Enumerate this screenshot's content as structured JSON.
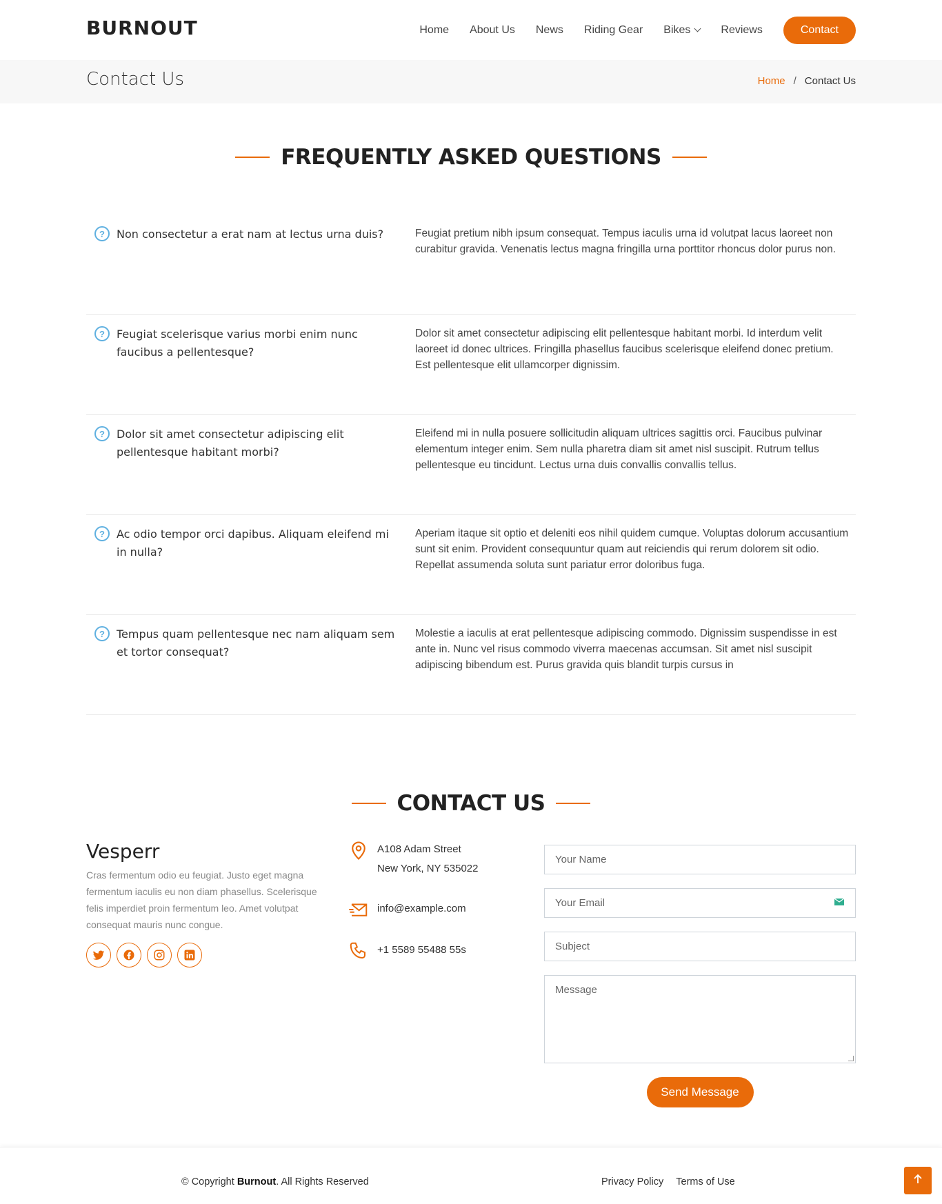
{
  "header": {
    "logo": "BURNOUT",
    "nav": [
      {
        "label": "Home"
      },
      {
        "label": "About Us"
      },
      {
        "label": "News"
      },
      {
        "label": "Riding Gear"
      },
      {
        "label": "Bikes"
      },
      {
        "label": "Reviews"
      }
    ],
    "contact_label": "Contact"
  },
  "breadcrumbs": {
    "title": "Contact Us",
    "home": "Home",
    "separator": "/",
    "current": "Contact Us"
  },
  "faq": {
    "title": "FREQUENTLY ASKED QUESTIONS",
    "items": [
      {
        "q": "Non consectetur a erat nam at lectus urna duis?",
        "a": "Feugiat pretium nibh ipsum consequat. Tempus iaculis urna id volutpat lacus laoreet non curabitur gravida. Venenatis lectus magna fringilla urna porttitor rhoncus dolor purus non."
      },
      {
        "q": "Feugiat scelerisque varius morbi enim nunc faucibus a pellentesque?",
        "a": "Dolor sit amet consectetur adipiscing elit pellentesque habitant morbi. Id interdum velit laoreet id donec ultrices. Fringilla phasellus faucibus scelerisque eleifend donec pretium. Est pellentesque elit ullamcorper dignissim."
      },
      {
        "q": "Dolor sit amet consectetur adipiscing elit pellentesque habitant morbi?",
        "a": "Eleifend mi in nulla posuere sollicitudin aliquam ultrices sagittis orci. Faucibus pulvinar elementum integer enim. Sem nulla pharetra diam sit amet nisl suscipit. Rutrum tellus pellentesque eu tincidunt. Lectus urna duis convallis convallis tellus."
      },
      {
        "q": "Ac odio tempor orci dapibus. Aliquam eleifend mi in nulla?",
        "a": "Aperiam itaque sit optio et deleniti eos nihil quidem cumque. Voluptas dolorum accusantium sunt sit enim. Provident consequuntur quam aut reiciendis qui rerum dolorem sit odio. Repellat assumenda soluta sunt pariatur error doloribus fuga."
      },
      {
        "q": "Tempus quam pellentesque nec nam aliquam sem et tortor consequat?",
        "a": "Molestie a iaculis at erat pellentesque adipiscing commodo. Dignissim suspendisse in est ante in. Nunc vel risus commodo viverra maecenas accumsan. Sit amet nisl suscipit adipiscing bibendum est. Purus gravida quis blandit turpis cursus in"
      }
    ]
  },
  "contact": {
    "title": "CONTACT US",
    "brand": "Vesperr",
    "about": "Cras fermentum odio eu feugiat. Justo eget magna fermentum iaculis eu non diam phasellus. Scelerisque felis imperdiet proin fermentum leo. Amet volutpat consequat mauris nunc congue.",
    "address_line1": "A108 Adam Street",
    "address_line2": "New York, NY 535022",
    "email": "info@example.com",
    "phone": "+1 5589 55488 55s",
    "form": {
      "name_placeholder": "Your Name",
      "email_placeholder": "Your Email",
      "subject_placeholder": "Subject",
      "message_placeholder": "Message",
      "send_label": "Send Message"
    }
  },
  "footer": {
    "copyright_prefix": "© Copyright",
    "copyright_brand": "Burnout",
    "copyright_suffix": ". All Rights Reserved",
    "privacy": "Privacy Policy",
    "terms": "Terms of Use"
  },
  "colors": {
    "accent": "#e96b0a",
    "question_icon": "#5fb0e0"
  }
}
